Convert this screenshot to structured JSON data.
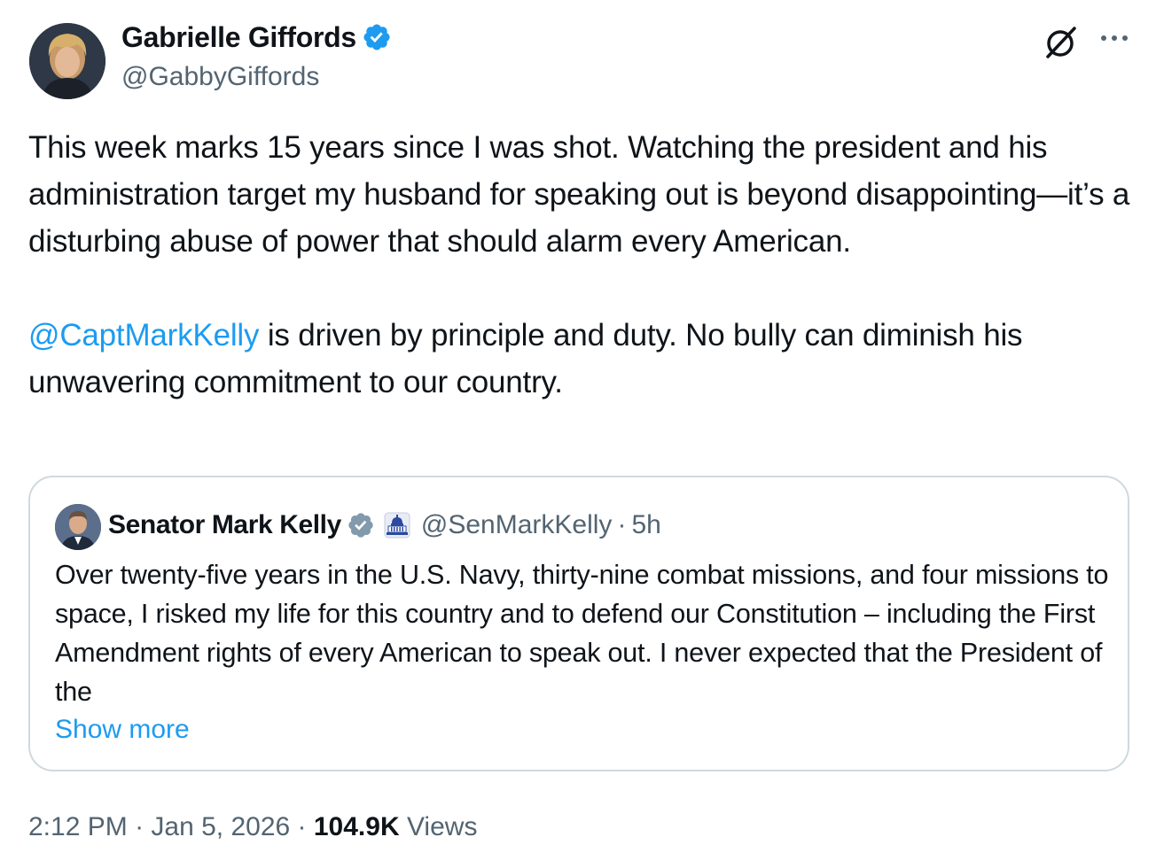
{
  "author": {
    "name": "Gabrielle Giffords",
    "handle": "@GabbyGiffords",
    "verified_icon": "verified-badge-icon"
  },
  "tweet": {
    "paragraph_1": "This week marks 15 years since I was shot. Watching the president and his administration target my husband for speaking out is beyond disappointing—it’s a disturbing abuse of power that should alarm every American.",
    "mention": "@CaptMarkKelly",
    "paragraph_2_rest": " is driven by principle and duty. No bully can diminish his unwavering commitment to our country."
  },
  "quote": {
    "name": "Senator Mark Kelly",
    "handle": "@SenMarkKelly",
    "separator": "·",
    "time": "5h",
    "affiliation_icon": "capitol-icon",
    "text": "Over twenty-five years in the U.S. Navy, thirty-nine combat missions, and four missions to space, I risked my life for this country and to defend our Constitution – including the First Amendment rights of every American to speak out. I never expected that the President of the",
    "show_more": "Show more"
  },
  "meta": {
    "time": "2:12 PM",
    "sep1": " · ",
    "date": "Jan 5, 2026",
    "sep2": " · ",
    "views_count": "104.9K",
    "views_label": " Views"
  },
  "colors": {
    "link": "#1d9bf0",
    "secondary_text": "#536471",
    "border": "#cfd9de",
    "verified_blue": "#1d9bf0",
    "verified_gray": "#829aab"
  }
}
